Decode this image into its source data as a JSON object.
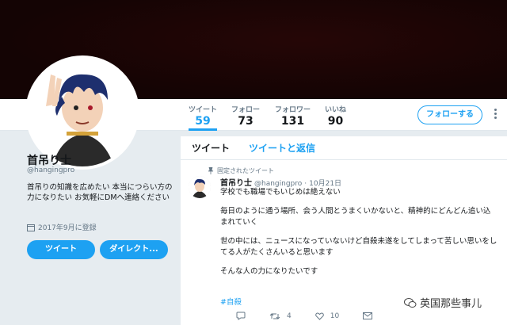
{
  "navbar": {
    "stats": [
      {
        "label": "ツイート",
        "value": "59"
      },
      {
        "label": "フォロー",
        "value": "73"
      },
      {
        "label": "フォロワー",
        "value": "131"
      },
      {
        "label": "いいね",
        "value": "90"
      }
    ],
    "follow_label": "フォローする"
  },
  "profile": {
    "name": "首吊り士",
    "handle": "@hangingpro",
    "bio": "首吊りの知識を広めたい 本当につらい方の力になりたい お気軽にDMへ連絡ください",
    "joined": "2017年9月に登録",
    "tweet_button": "ツイート",
    "direct_button": "ダイレクト..."
  },
  "feed": {
    "tabs": [
      "ツイート",
      "ツイートと返信"
    ],
    "pinned_label": "固定されたツイート",
    "tweet": {
      "author": "首吊り士",
      "handle": "@hangingpro",
      "date": "10月21日",
      "lines": [
        "学校でも職場でもいじめは絶えない",
        "毎日のように通う場所、会う人間とうまくいかないと、精神的にどんどん追い込まれていく",
        "世の中には、ニュースになっていないけど自殺未遂をしてしまって苦しい思いをしてる人がたくさんいると思います",
        "そんな人の力になりたいです"
      ],
      "hashtag": "#自殺",
      "retweets": "4",
      "likes": "10"
    }
  },
  "watermark": "英国那些事儿",
  "colors": {
    "accent": "#1da1f2",
    "banner": "#140404"
  }
}
